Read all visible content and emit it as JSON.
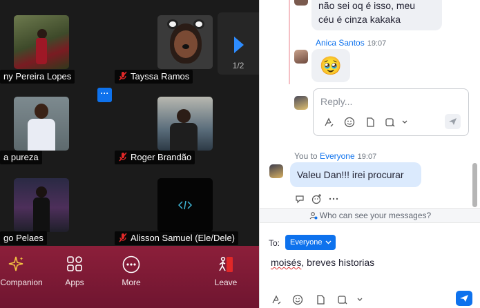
{
  "video_grid": {
    "participants": [
      {
        "name": "ny Pereira Lopes",
        "muted": false
      },
      {
        "name": "Tayssa Ramos",
        "muted": true
      },
      {
        "name": "a pureza",
        "muted": false
      },
      {
        "name": "Roger Brandão",
        "muted": true
      },
      {
        "name": "go Pelaes",
        "muted": false
      },
      {
        "name": "Alisson Samuel (Ele/Dele)",
        "muted": true
      }
    ],
    "page_indicator": "1/2",
    "more_button": "···"
  },
  "toolbar": {
    "items": [
      {
        "label": "Companion",
        "icon": "sparkle-icon"
      },
      {
        "label": "Apps",
        "icon": "apps-icon"
      },
      {
        "label": "More",
        "icon": "more-icon"
      },
      {
        "label": "Leave",
        "icon": "leave-icon"
      }
    ],
    "colors": {
      "background": "#8c1f3a"
    }
  },
  "chat": {
    "messages": [
      {
        "sender": "",
        "time": "",
        "text_lines": [
          "não sei oq é isso, meu",
          "céu é cinza kakaka"
        ]
      },
      {
        "sender": "Anica Santos",
        "time": "19:07",
        "text": "🥹"
      },
      {
        "sender": "You",
        "to_prefix": "to",
        "to": "Everyone",
        "time": "19:07",
        "text": "Valeu Dan!!! irei procurar"
      }
    ],
    "reply_placeholder": "Reply...",
    "who_can_see": "Who can see your messages?",
    "to_label": "To:",
    "recipient": "Everyone",
    "composer_text": {
      "word1": "moisés",
      "rest": ", breves historias"
    },
    "colors": {
      "accent": "#0e72ed",
      "bubble": "#eef0f4"
    }
  }
}
